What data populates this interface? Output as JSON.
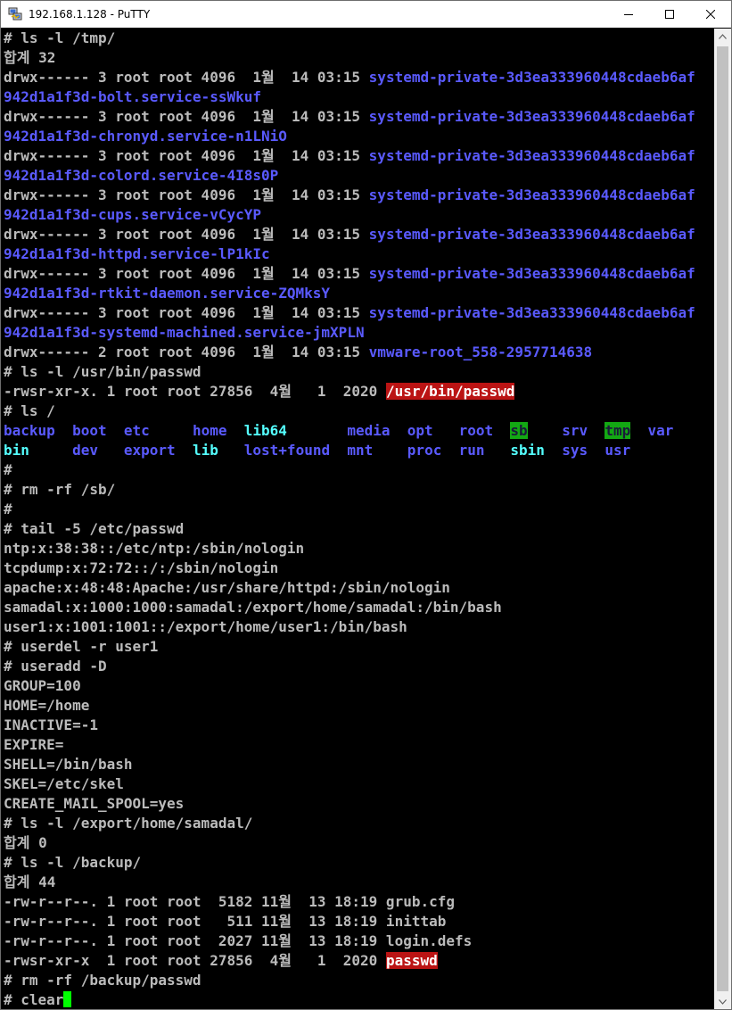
{
  "window": {
    "title": "192.168.1.128 - PuTTY",
    "app_icon": "putty-computers-icon",
    "controls": {
      "minimize": "minimize-icon",
      "maximize": "maximize-icon",
      "close": "close-icon"
    }
  },
  "colors": {
    "background": "#000000",
    "text": "#bbbbbb",
    "directory": "#5a5aff",
    "symlink": "#54ffff",
    "setuid_bg": "#bb1414",
    "sticky_bg": "#13a813",
    "cursor": "#00ff00"
  },
  "terminal": {
    "lines": [
      [
        {
          "t": "# ls -l /tmp/"
        }
      ],
      [
        {
          "t": "합계 32"
        }
      ],
      [
        {
          "t": "drwx------ 3 root root 4096  1월  14 03:15 "
        },
        {
          "t": "systemd-private-3d3ea333960448cdaeb6af",
          "c": "dir"
        }
      ],
      [
        {
          "t": "942d1a1f3d-bolt.service-ssWkuf",
          "c": "dir"
        }
      ],
      [
        {
          "t": "drwx------ 3 root root 4096  1월  14 03:15 "
        },
        {
          "t": "systemd-private-3d3ea333960448cdaeb6af",
          "c": "dir"
        }
      ],
      [
        {
          "t": "942d1a1f3d-chronyd.service-n1LNiO",
          "c": "dir"
        }
      ],
      [
        {
          "t": "drwx------ 3 root root 4096  1월  14 03:15 "
        },
        {
          "t": "systemd-private-3d3ea333960448cdaeb6af",
          "c": "dir"
        }
      ],
      [
        {
          "t": "942d1a1f3d-colord.service-4I8s0P",
          "c": "dir"
        }
      ],
      [
        {
          "t": "drwx------ 3 root root 4096  1월  14 03:15 "
        },
        {
          "t": "systemd-private-3d3ea333960448cdaeb6af",
          "c": "dir"
        }
      ],
      [
        {
          "t": "942d1a1f3d-cups.service-vCycYP",
          "c": "dir"
        }
      ],
      [
        {
          "t": "drwx------ 3 root root 4096  1월  14 03:15 "
        },
        {
          "t": "systemd-private-3d3ea333960448cdaeb6af",
          "c": "dir"
        }
      ],
      [
        {
          "t": "942d1a1f3d-httpd.service-lP1kIc",
          "c": "dir"
        }
      ],
      [
        {
          "t": "drwx------ 3 root root 4096  1월  14 03:15 "
        },
        {
          "t": "systemd-private-3d3ea333960448cdaeb6af",
          "c": "dir"
        }
      ],
      [
        {
          "t": "942d1a1f3d-rtkit-daemon.service-ZQMksY",
          "c": "dir"
        }
      ],
      [
        {
          "t": "drwx------ 3 root root 4096  1월  14 03:15 "
        },
        {
          "t": "systemd-private-3d3ea333960448cdaeb6af",
          "c": "dir"
        }
      ],
      [
        {
          "t": "942d1a1f3d-systemd-machined.service-jmXPLN",
          "c": "dir"
        }
      ],
      [
        {
          "t": "drwx------ 2 root root 4096  1월  14 03:15 "
        },
        {
          "t": "vmware-root_558-2957714638",
          "c": "dir"
        }
      ],
      [
        {
          "t": "# ls -l /usr/bin/passwd"
        }
      ],
      [
        {
          "t": "-rwsr-xr-x. 1 root root 27856  4월   1  2020 "
        },
        {
          "t": "/usr/bin/passwd",
          "c": "suid"
        }
      ],
      [
        {
          "t": "# ls /"
        }
      ],
      [
        {
          "t": "backup",
          "c": "dir"
        },
        {
          "t": "  "
        },
        {
          "t": "boot",
          "c": "dir"
        },
        {
          "t": "  "
        },
        {
          "t": "etc",
          "c": "dir"
        },
        {
          "t": "     "
        },
        {
          "t": "home",
          "c": "dir"
        },
        {
          "t": "  "
        },
        {
          "t": "lib64",
          "c": "cyan"
        },
        {
          "t": "       "
        },
        {
          "t": "media",
          "c": "dir"
        },
        {
          "t": "  "
        },
        {
          "t": "opt",
          "c": "dir"
        },
        {
          "t": "   "
        },
        {
          "t": "root",
          "c": "dir"
        },
        {
          "t": "  "
        },
        {
          "t": "sb",
          "c": "sticky"
        },
        {
          "t": "    "
        },
        {
          "t": "srv",
          "c": "dir"
        },
        {
          "t": "  "
        },
        {
          "t": "tmp",
          "c": "sticky"
        },
        {
          "t": "  "
        },
        {
          "t": "var",
          "c": "dir"
        }
      ],
      [
        {
          "t": "bin",
          "c": "cyan"
        },
        {
          "t": "     "
        },
        {
          "t": "dev",
          "c": "dir"
        },
        {
          "t": "   "
        },
        {
          "t": "export",
          "c": "dir"
        },
        {
          "t": "  "
        },
        {
          "t": "lib",
          "c": "cyan"
        },
        {
          "t": "   "
        },
        {
          "t": "lost+found",
          "c": "dir"
        },
        {
          "t": "  "
        },
        {
          "t": "mnt",
          "c": "dir"
        },
        {
          "t": "    "
        },
        {
          "t": "proc",
          "c": "dir"
        },
        {
          "t": "  "
        },
        {
          "t": "run",
          "c": "dir"
        },
        {
          "t": "   "
        },
        {
          "t": "sbin",
          "c": "cyan"
        },
        {
          "t": "  "
        },
        {
          "t": "sys",
          "c": "dir"
        },
        {
          "t": "  "
        },
        {
          "t": "usr",
          "c": "dir"
        }
      ],
      [
        {
          "t": "#"
        }
      ],
      [
        {
          "t": "# rm -rf /sb/"
        }
      ],
      [
        {
          "t": "#"
        }
      ],
      [
        {
          "t": "# tail -5 /etc/passwd"
        }
      ],
      [
        {
          "t": "ntp:x:38:38::/etc/ntp:/sbin/nologin"
        }
      ],
      [
        {
          "t": "tcpdump:x:72:72::/:/sbin/nologin"
        }
      ],
      [
        {
          "t": "apache:x:48:48:Apache:/usr/share/httpd:/sbin/nologin"
        }
      ],
      [
        {
          "t": "samadal:x:1000:1000:samadal:/export/home/samadal:/bin/bash"
        }
      ],
      [
        {
          "t": "user1:x:1001:1001::/export/home/user1:/bin/bash"
        }
      ],
      [
        {
          "t": "# userdel -r user1"
        }
      ],
      [
        {
          "t": "# useradd -D"
        }
      ],
      [
        {
          "t": "GROUP=100"
        }
      ],
      [
        {
          "t": "HOME=/home"
        }
      ],
      [
        {
          "t": "INACTIVE=-1"
        }
      ],
      [
        {
          "t": "EXPIRE="
        }
      ],
      [
        {
          "t": "SHELL=/bin/bash"
        }
      ],
      [
        {
          "t": "SKEL=/etc/skel"
        }
      ],
      [
        {
          "t": "CREATE_MAIL_SPOOL=yes"
        }
      ],
      [
        {
          "t": "# ls -l /export/home/samadal/"
        }
      ],
      [
        {
          "t": "합계 0"
        }
      ],
      [
        {
          "t": "# ls -l /backup/"
        }
      ],
      [
        {
          "t": "합계 44"
        }
      ],
      [
        {
          "t": "-rw-r--r--. 1 root root  5182 11월  13 18:19 grub.cfg"
        }
      ],
      [
        {
          "t": "-rw-r--r--. 1 root root   511 11월  13 18:19 inittab"
        }
      ],
      [
        {
          "t": "-rw-r--r--. 1 root root  2027 11월  13 18:19 login.defs"
        }
      ],
      [
        {
          "t": "-rwsr-xr-x  1 root root 27856  4월   1  2020 "
        },
        {
          "t": "passwd",
          "c": "suid"
        }
      ],
      [
        {
          "t": "# rm -rf /backup/passwd"
        }
      ],
      [
        {
          "t": "# clear"
        },
        {
          "t": "",
          "c": "cursor"
        }
      ]
    ]
  },
  "scrollbar": {
    "up": "scroll-up-arrow-icon",
    "down": "scroll-down-arrow-icon"
  }
}
